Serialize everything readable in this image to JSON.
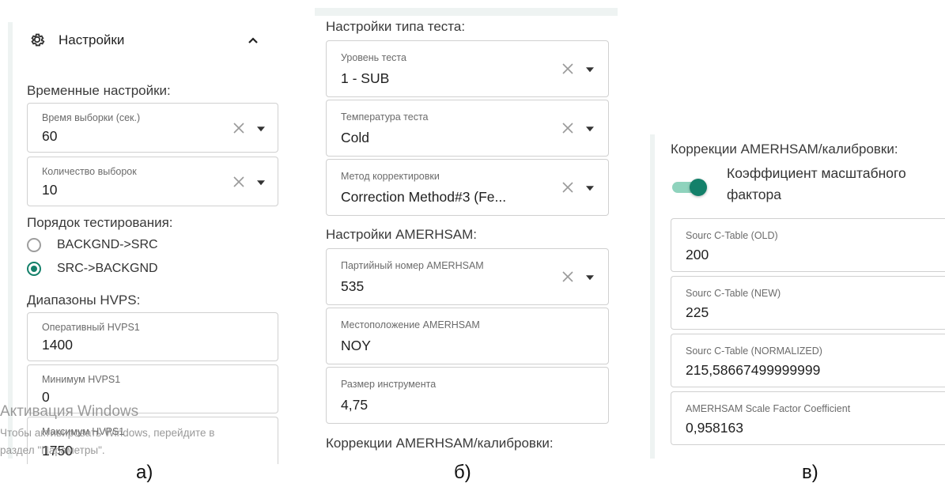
{
  "panel_a": {
    "header": {
      "title": "Настройки",
      "settings_icon": "gear-icon",
      "collapse_icon": "chevron-up-icon"
    },
    "time_section": "Временные настройки:",
    "fields_time": [
      {
        "label": "Время выборки (сек.)",
        "value": "60"
      },
      {
        "label": "Количество выборок",
        "value": "10"
      }
    ],
    "order_section": "Порядок тестирования:",
    "radios": [
      {
        "label": "BACKGND->SRC",
        "selected": false
      },
      {
        "label": "SRC->BACKGND",
        "selected": true
      }
    ],
    "hvps_section": "Диапазоны HVPS:",
    "fields_hvps": [
      {
        "label": "Оперативный HVPS1",
        "value": "1400"
      },
      {
        "label": "Минимум HVPS1",
        "value": "0"
      },
      {
        "label": "Максимум HVPS1",
        "value": "1750"
      }
    ],
    "watermark": {
      "title": "Активация Windows",
      "line1": "Чтобы активировать Windows, перейдите в",
      "line2": "раздел \"Параметры\"."
    }
  },
  "panel_b": {
    "test_section": "Настройки типа теста:",
    "fields_test": [
      {
        "label": "Уровень теста",
        "value": "1 - SUB"
      },
      {
        "label": "Температура теста",
        "value": "Cold"
      },
      {
        "label": "Метод корректировки",
        "value": "Correction Method#3 (Fe..."
      }
    ],
    "amerhsam_section": "Настройки AMERHSAM:",
    "fields_amerhsam": [
      {
        "label": "Партийный номер AMERHSAM",
        "value": "535"
      },
      {
        "label": "Местоположение AMERHSAM",
        "value": "NOY"
      },
      {
        "label": "Размер инструмента",
        "value": "4,75"
      }
    ],
    "corrections_section": "Коррекции AMERHSAM/калибровки:"
  },
  "panel_c": {
    "corrections_section": "Коррекции AMERHSAM/калибровки:",
    "toggle": {
      "line1": "Коэффициент масштабного",
      "line2": "фактора",
      "on": true
    },
    "fields": [
      {
        "label": "Sourc C-Table (OLD)",
        "value": "200"
      },
      {
        "label": "Sourc C-Table (NEW)",
        "value": "225"
      },
      {
        "label": "Sourc C-Table (NORMALIZED)",
        "value": "215,58667499999999"
      },
      {
        "label": "AMERHSAM Scale Factor Coefficient",
        "value": "0,958163"
      }
    ]
  },
  "captions": {
    "a": "а)",
    "b": "б)",
    "c": "в)"
  },
  "colors": {
    "accent": "#14806a",
    "toggle_track": "#8fd3bd",
    "border": "#d0d0d0",
    "panel_strip": "#e8f0ee"
  }
}
